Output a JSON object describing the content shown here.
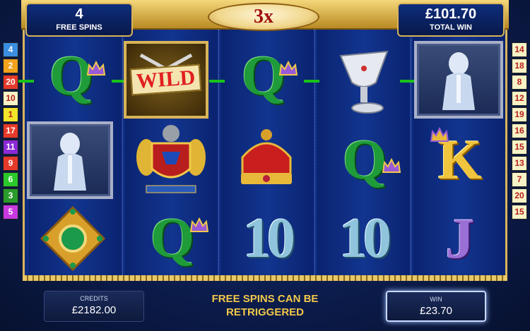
{
  "header": {
    "free_spins_count": "4",
    "free_spins_label": "FREE SPINS",
    "multiplier": "3x",
    "total_win_value": "£101.70",
    "total_win_label": "TOTAL WIN"
  },
  "paylines": {
    "left": [
      {
        "n": "4",
        "color": "#3a8de0"
      },
      {
        "n": "2",
        "color": "#f2a21c"
      },
      {
        "n": "20",
        "color": "#e43a2a"
      },
      {
        "n": "10",
        "color": "#f7f3c6"
      },
      {
        "n": "1",
        "color": "#f2e42a"
      },
      {
        "n": "17",
        "color": "#e63a2a"
      },
      {
        "n": "11",
        "color": "#8a2ad8"
      },
      {
        "n": "9",
        "color": "#e43a2a"
      },
      {
        "n": "6",
        "color": "#2ac82a"
      },
      {
        "n": "3",
        "color": "#2a9a2a"
      },
      {
        "n": "5",
        "color": "#c83ae0"
      }
    ],
    "right": [
      {
        "n": "14",
        "color": "#f7f3c6"
      },
      {
        "n": "18",
        "color": "#f7f3c6"
      },
      {
        "n": "8",
        "color": "#f7f3c6"
      },
      {
        "n": "12",
        "color": "#f7f3c6"
      },
      {
        "n": "19",
        "color": "#f7f3c6"
      },
      {
        "n": "16",
        "color": "#f7f3c6"
      },
      {
        "n": "15",
        "color": "#f7f3c6"
      },
      {
        "n": "13",
        "color": "#f7f3c6"
      },
      {
        "n": "7",
        "color": "#f7f3c6"
      },
      {
        "n": "20",
        "color": "#f7f3c6"
      },
      {
        "n": "15",
        "color": "#f7f3c6"
      }
    ]
  },
  "reels": {
    "symbols": [
      "Q",
      "WILD",
      "Q",
      "10",
      "10",
      "Q",
      "Q",
      "K",
      "J"
    ],
    "wild_label": "WILD"
  },
  "footer": {
    "credits_label": "CREDITS",
    "credits_value": "£2182.00",
    "message_line1": "FREE SPINS CAN BE",
    "message_line2": "RETRIGGERED",
    "win_label": "WIN",
    "win_value": "£23.70"
  },
  "colors": {
    "accent_gold": "#d8b45a",
    "reel_blue": "#0d2b80",
    "payline_green": "#19c219",
    "message_gold": "#f2c84a"
  }
}
